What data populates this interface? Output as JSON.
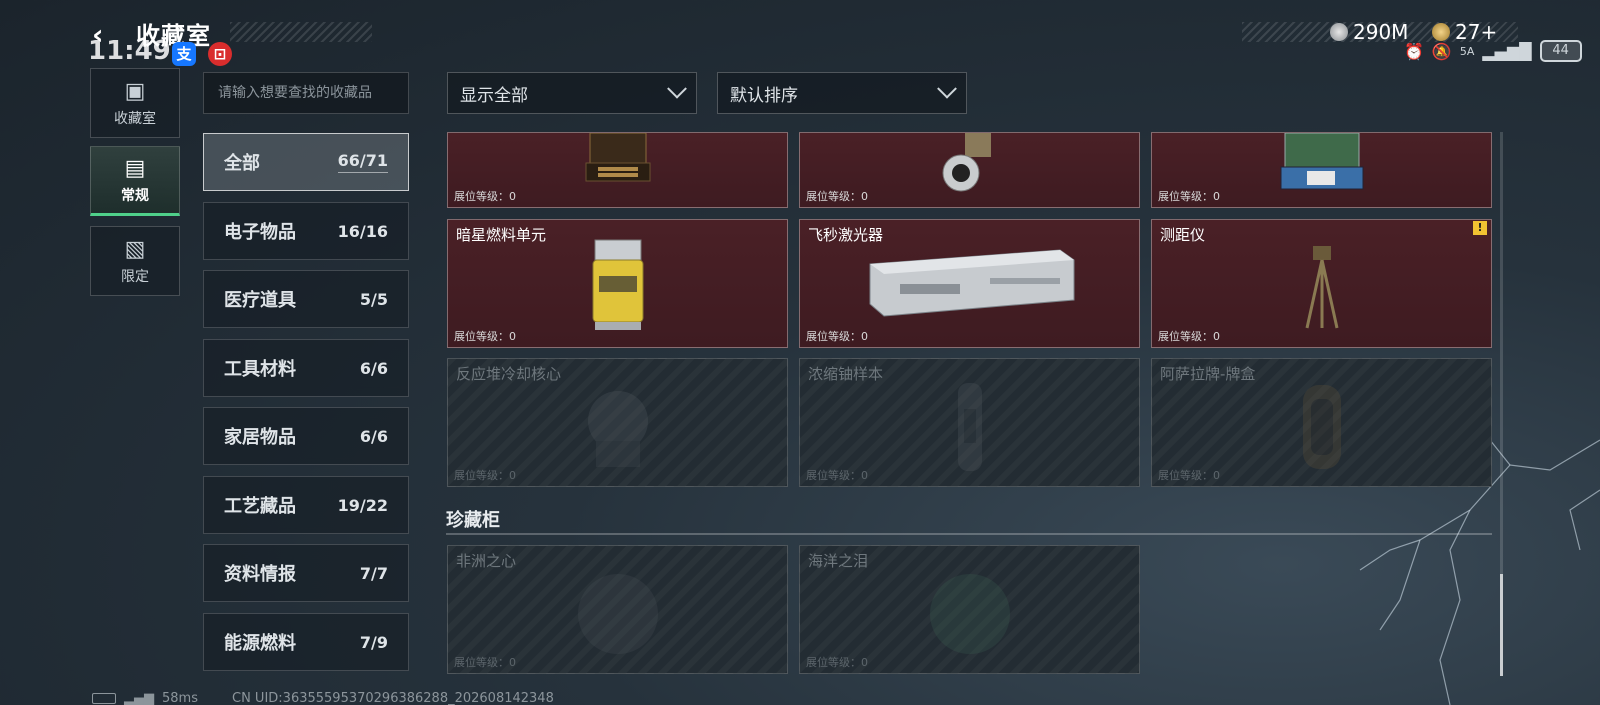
{
  "header": {
    "title": "收藏室",
    "clock": "11:49",
    "currency_1": "290M",
    "currency_2": "27+",
    "network_label": "5A",
    "battery": "44"
  },
  "rail": [
    {
      "label": "收藏室",
      "icon": "vault-icon"
    },
    {
      "label": "常规",
      "icon": "collection-icon",
      "active": true
    },
    {
      "label": "限定",
      "icon": "limited-icon"
    }
  ],
  "search": {
    "placeholder": "请输入想要查找的收藏品"
  },
  "filters": {
    "show": "显示全部",
    "sort": "默认排序"
  },
  "categories": [
    {
      "name": "全部",
      "count": "66/71",
      "active": true
    },
    {
      "name": "电子物品",
      "count": "16/16"
    },
    {
      "name": "医疗道具",
      "count": "5/5"
    },
    {
      "name": "工具材料",
      "count": "6/6"
    },
    {
      "name": "家居物品",
      "count": "6/6"
    },
    {
      "name": "工艺藏品",
      "count": "19/22"
    },
    {
      "name": "资料情报",
      "count": "7/7"
    },
    {
      "name": "能源燃料",
      "count": "7/9"
    }
  ],
  "grid": {
    "level_label": "展位等级：0",
    "row0": [
      {
        "name": ""
      },
      {
        "name": ""
      },
      {
        "name": ""
      }
    ],
    "row1": [
      {
        "name": "暗星燃料单元"
      },
      {
        "name": "飞秒激光器"
      },
      {
        "name": "测距仪",
        "warning": "!"
      }
    ],
    "row2": [
      {
        "name": "反应堆冷却核心"
      },
      {
        "name": "浓缩铀样本"
      },
      {
        "name": "阿萨拉牌-牌盒"
      }
    ]
  },
  "section": {
    "title": "珍藏柜",
    "items": [
      {
        "name": "非洲之心"
      },
      {
        "name": "海洋之泪"
      }
    ]
  },
  "footer": {
    "ping": "58ms",
    "uid": "CN UID:36355595370296386288_202608142348"
  },
  "colors": {
    "owned_card": "#4a2026",
    "locked_card": "#232c33",
    "accent_green": "#4fd08a",
    "warning": "#f1c232"
  }
}
